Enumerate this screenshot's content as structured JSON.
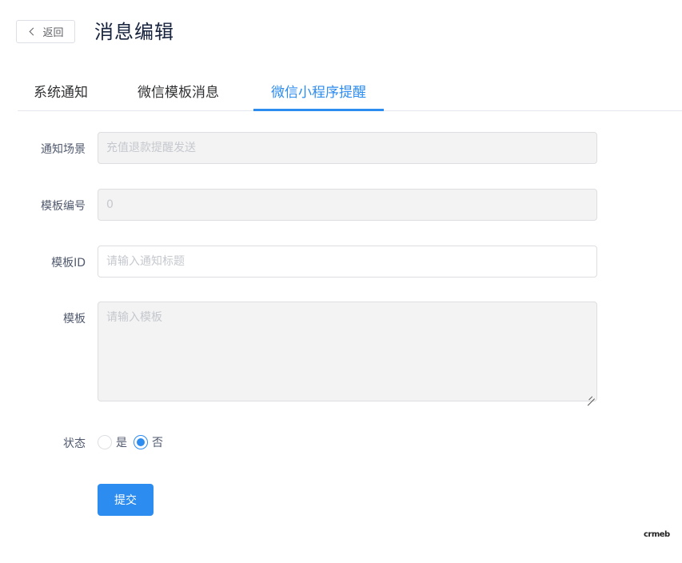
{
  "header": {
    "back_label": "返回",
    "title": "消息编辑"
  },
  "tabs": [
    {
      "label": "系统通知",
      "active": false
    },
    {
      "label": "微信模板消息",
      "active": false
    },
    {
      "label": "微信小程序提醒",
      "active": true
    }
  ],
  "form": {
    "scene": {
      "label": "通知场景",
      "value": "充值退款提醒发送",
      "disabled": true
    },
    "template_no": {
      "label": "模板编号",
      "value": "0",
      "disabled": true
    },
    "template_id": {
      "label": "模板ID",
      "placeholder": "请输入通知标题"
    },
    "template": {
      "label": "模板",
      "placeholder": "请输入模板",
      "disabled": true
    },
    "status": {
      "label": "状态",
      "options": [
        {
          "label": "是",
          "checked": false
        },
        {
          "label": "否",
          "checked": true
        }
      ]
    },
    "submit_label": "提交"
  },
  "logo": {
    "text": "crmeb"
  },
  "colors": {
    "primary": "#2d8cf0",
    "disabled_bg": "#f3f3f3",
    "border": "#dcdee2"
  }
}
